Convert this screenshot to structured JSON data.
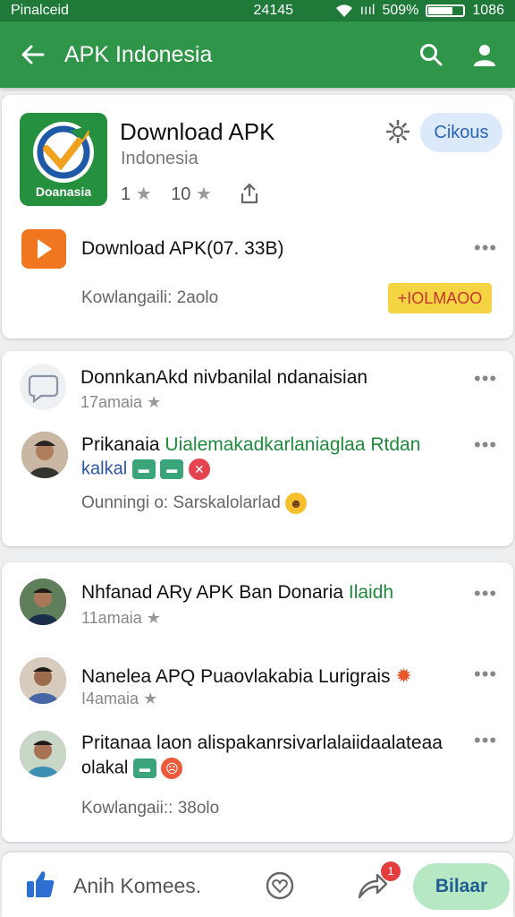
{
  "status_bar": {
    "left_text": "Pinalceid",
    "time": "24145",
    "signal": "ıııl",
    "battery_pct": "509%",
    "battery_level": 0.7,
    "clock_right": "1086"
  },
  "app_bar": {
    "title": "APK Indonesia",
    "back_icon": "arrow-left-icon",
    "search_icon": "search-icon",
    "account_icon": "person-icon"
  },
  "app_card": {
    "app_name": "Download APK",
    "developer": "Indonesia",
    "icon_label": "Doanasia",
    "rating_left": "1",
    "rating_right": "10",
    "settings_icon": "gear-icon",
    "share_icon": "share-icon",
    "action_button": "Cikous",
    "download_title": "Download APK(07. 33B)",
    "download_meta": "Kowlangaili: 2aolo",
    "highlight_badge": "+IOLMAOO",
    "colors": {
      "brand": "#25913f",
      "accent_button": "#dbe9fb",
      "play": "#f0771f",
      "badge": "#f5d444"
    }
  },
  "comments_card_1": {
    "items": [
      {
        "text": "DonnkanAkd nivbanilal ndanaisian",
        "sub": "17amaia"
      },
      {
        "text_a": "Prikanaia",
        "text_b": "Uialemakadkarlaniaglaa Rtdan",
        "line2": "kalkal",
        "meta": "Ounningi o: Sarskalolarlad"
      }
    ]
  },
  "comments_card_2": {
    "items": [
      {
        "text_a": "Nhfanad ARy APK Ban Donaria",
        "text_b": "Ilaidh",
        "sub": "11amaia"
      },
      {
        "text": "Nanelea APQ Puaovlakabia Lurigrais",
        "sub": "I4amaia"
      },
      {
        "text": "Pritanaa laon alispakanrsivarlalaiidaalateaa",
        "line2": "olakal"
      }
    ],
    "meta": "Kowlangaii:: 38olo"
  },
  "bottom_bar": {
    "input_placeholder": "Anih Komees.",
    "like_icon": "thumbs-up-icon",
    "heart_icon": "heart-icon",
    "share_icon": "share-arrow-icon",
    "notification_count": "1",
    "send_button": "Bilaar"
  }
}
